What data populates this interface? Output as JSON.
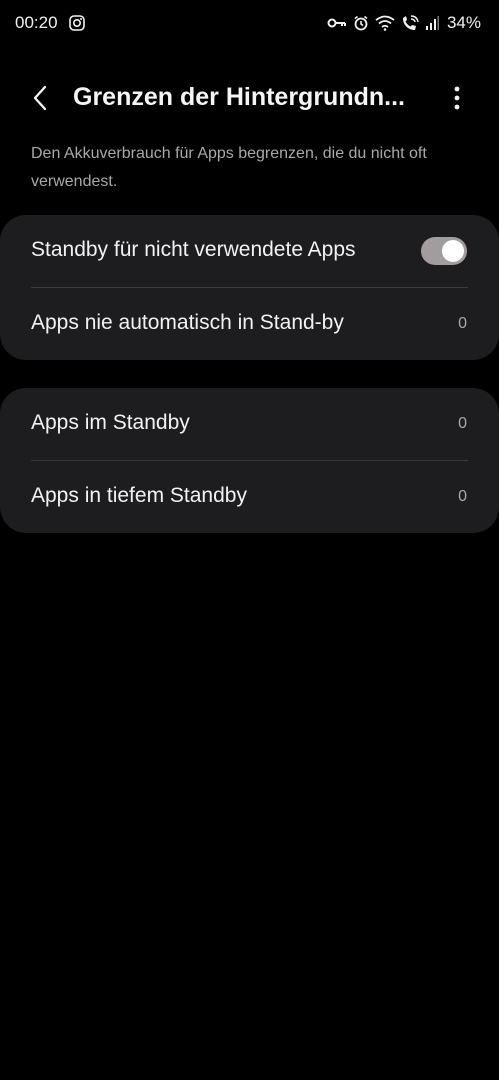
{
  "status_bar": {
    "time": "00:20",
    "battery": "34%",
    "icons": [
      "instagram-icon",
      "key-icon",
      "alarm-icon",
      "wifi-icon",
      "wifi-call-icon",
      "signal-icon"
    ]
  },
  "header": {
    "title": "Grenzen der Hintergrundn...",
    "back_icon": "chevron-left-icon",
    "more_icon": "more-vertical-icon"
  },
  "description": "Den Akkuverbrauch für Apps begrenzen, die du nicht oft verwendest.",
  "cards": [
    {
      "rows": [
        {
          "label": "Standby für nicht verwendete Apps",
          "toggle_on": true
        },
        {
          "label": "Apps nie automatisch in Stand-by",
          "count": "0"
        }
      ]
    },
    {
      "rows": [
        {
          "label": "Apps im Standby",
          "count": "0"
        },
        {
          "label": "Apps in tiefem Standby",
          "count": "0"
        }
      ]
    }
  ],
  "colors": {
    "background": "#000000",
    "card": "#1d1c1e",
    "toggle_track": "#a39c9f",
    "secondary_text": "#a9a9a9"
  }
}
